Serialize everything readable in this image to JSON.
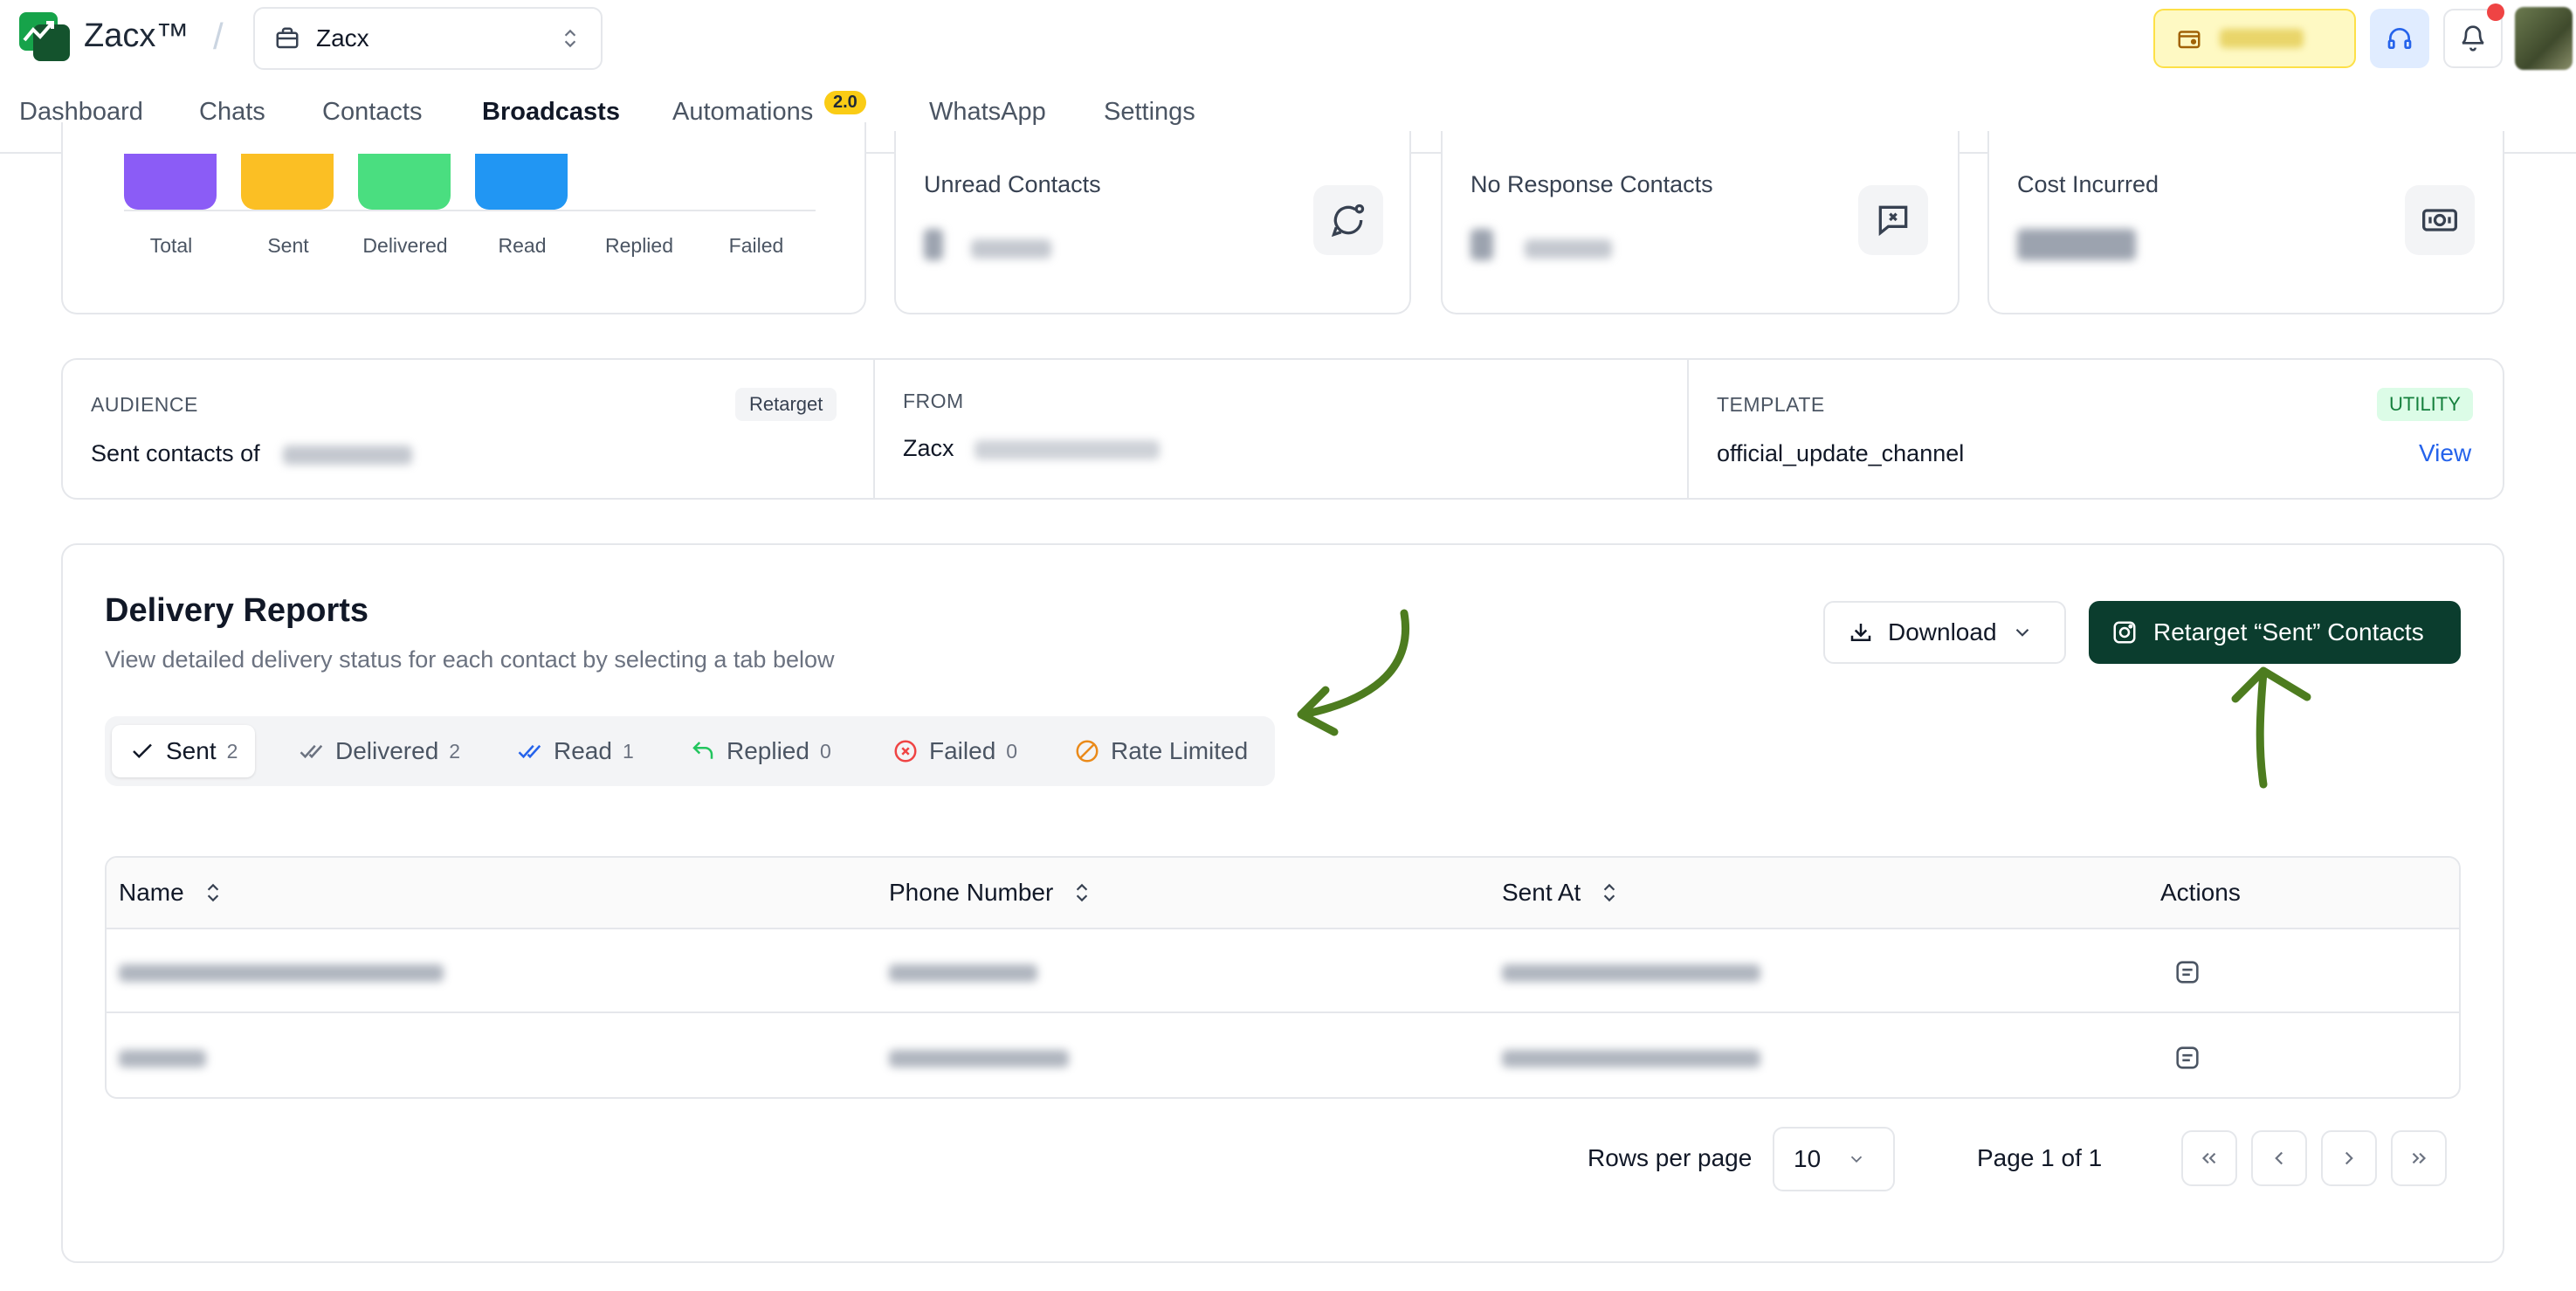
{
  "header": {
    "app_name": "Zacx™",
    "workspace": "Zacx",
    "nav": [
      {
        "label": "Dashboard"
      },
      {
        "label": "Chats"
      },
      {
        "label": "Contacts"
      },
      {
        "label": "Broadcasts"
      },
      {
        "label": "Automations",
        "badge": "2.0"
      },
      {
        "label": "WhatsApp"
      },
      {
        "label": "Settings"
      }
    ],
    "active_nav": "Broadcasts"
  },
  "summary_chart": {
    "labels": [
      "Total",
      "Sent",
      "Delivered",
      "Read",
      "Replied",
      "Failed"
    ],
    "colors": [
      "#8b5cf6",
      "#fbbf24",
      "#4ade80",
      "#2196f3"
    ]
  },
  "stats": [
    {
      "title": "Unread Contacts",
      "icon": "message-circle-icon"
    },
    {
      "title": "No Response Contacts",
      "icon": "message-x-icon"
    },
    {
      "title": "Cost Incurred",
      "icon": "banknote-icon"
    }
  ],
  "info": {
    "audience_label": "AUDIENCE",
    "audience_badge": "Retarget",
    "audience_value": "Sent contacts of",
    "from_label": "FROM",
    "from_value": "Zacx",
    "template_label": "TEMPLATE",
    "template_badge": "UTILITY",
    "template_value": "official_update_channel",
    "view_link": "View"
  },
  "reports": {
    "title": "Delivery Reports",
    "subtitle": "View detailed delivery status for each contact by selecting a tab below",
    "download_label": "Download",
    "retarget_label": "Retarget “Sent” Contacts",
    "tabs": [
      {
        "label": "Sent",
        "count": "2"
      },
      {
        "label": "Delivered",
        "count": "2"
      },
      {
        "label": "Read",
        "count": "1"
      },
      {
        "label": "Replied",
        "count": "0"
      },
      {
        "label": "Failed",
        "count": "0"
      },
      {
        "label": "Rate Limited",
        "count": ""
      }
    ],
    "columns": [
      "Name",
      "Phone Number",
      "Sent At",
      "Actions"
    ],
    "rows_per_page_label": "Rows per page",
    "rows_per_page_value": "10",
    "page_info": "Page 1 of 1"
  },
  "colors": {
    "primary": "#0b3d2e",
    "accent_link": "#2563eb",
    "annotation": "#4d7c1f"
  }
}
